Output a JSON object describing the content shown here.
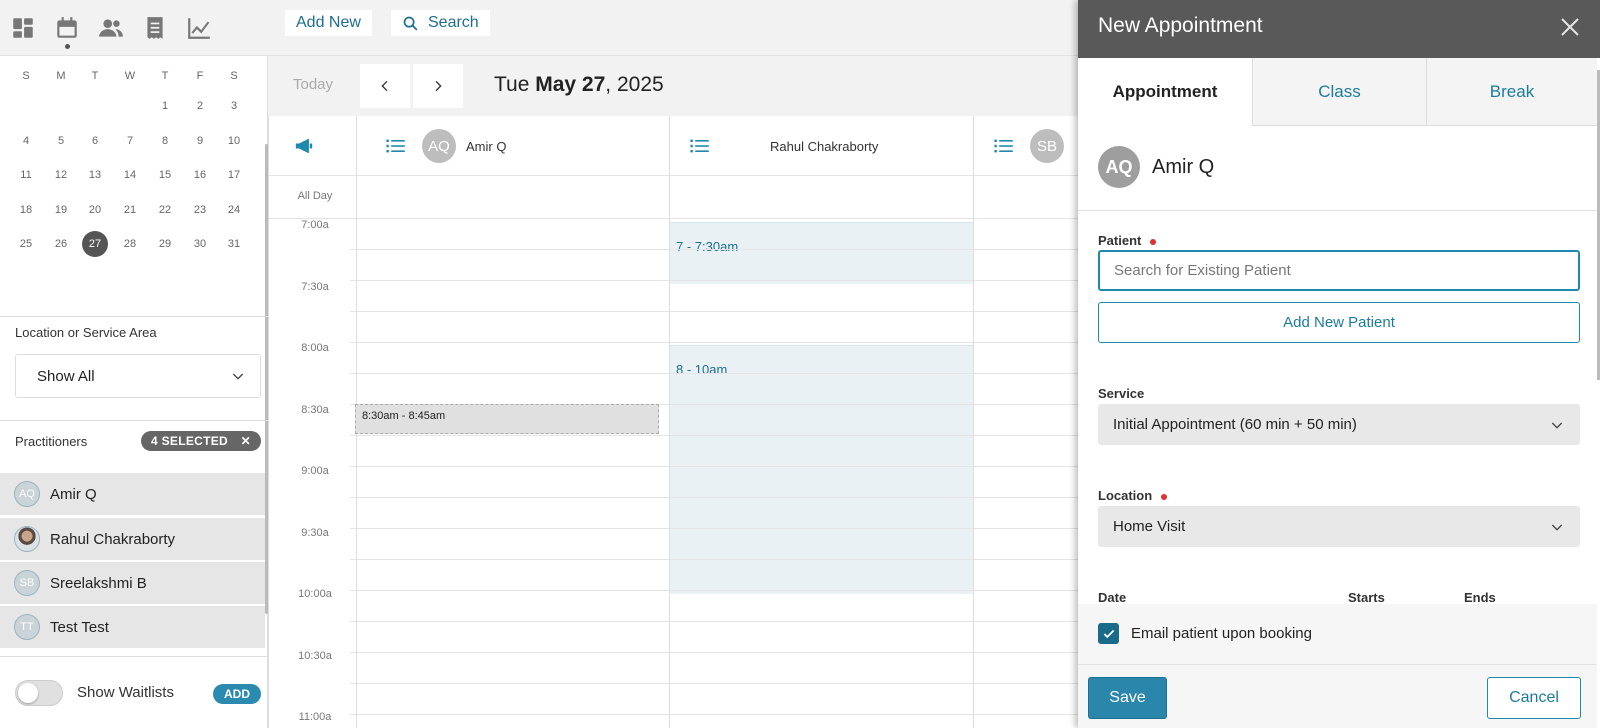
{
  "toolbar": {
    "add_new_label": "Add New",
    "search_label": "Search"
  },
  "mini_calendar": {
    "weekdays": [
      "S",
      "M",
      "T",
      "W",
      "T",
      "F",
      "S"
    ],
    "weeks": [
      [
        "",
        "",
        "",
        "",
        "1",
        "2",
        "3"
      ],
      [
        "4",
        "5",
        "6",
        "7",
        "8",
        "9",
        "10"
      ],
      [
        "11",
        "12",
        "13",
        "14",
        "15",
        "16",
        "17"
      ],
      [
        "18",
        "19",
        "20",
        "21",
        "22",
        "23",
        "24"
      ],
      [
        "25",
        "26",
        "27",
        "28",
        "29",
        "30",
        "31"
      ]
    ],
    "selected_day": "27"
  },
  "location_filter": {
    "label": "Location or Service Area",
    "value": "Show All"
  },
  "practitioners": {
    "label": "Practitioners",
    "selected_badge": "4 SELECTED",
    "list": [
      {
        "initials": "AQ",
        "name": "Amir Q"
      },
      {
        "initials": "",
        "name": "Rahul Chakraborty"
      },
      {
        "initials": "SB",
        "name": "Sreelakshmi B"
      },
      {
        "initials": "TT",
        "name": "Test Test"
      }
    ]
  },
  "waitlist": {
    "label": "Show Waitlists",
    "add_label": "ADD"
  },
  "calendar": {
    "today_label": "Today",
    "date_weekday": "Tue ",
    "date_bold": "May 27",
    "date_year": ", 2025",
    "all_day_label": "All Day",
    "columns": [
      {
        "initials": "AQ",
        "name": "Amir Q"
      },
      {
        "initials": "",
        "name": "Rahul Chakraborty"
      },
      {
        "initials": "SB",
        "name": ""
      }
    ],
    "time_labels": [
      "7:00a",
      "7:30a",
      "8:00a",
      "8:30a",
      "9:00a",
      "9:30a",
      "10:00a",
      "10:30a",
      "11:00a"
    ],
    "availability": [
      {
        "label": "7 - 7:30am"
      },
      {
        "label": "8 - 10am"
      }
    ],
    "pending_block": "8:30am - 8:45am"
  },
  "panel": {
    "title": "New Appointment",
    "tabs": [
      "Appointment",
      "Class",
      "Break"
    ],
    "practitioner_initials": "AQ",
    "practitioner_name": "Amir Q",
    "patient_label": "Patient",
    "patient_placeholder": "Search for Existing Patient",
    "add_patient_label": "Add New Patient",
    "service_label": "Service",
    "service_value": "Initial Appointment (60 min + 50 min)",
    "location_label": "Location",
    "location_value": "Home Visit",
    "date_header": "Date",
    "starts_header": "Starts",
    "ends_header": "Ends",
    "email_label": "Email patient upon booking",
    "email_checked": true,
    "save_label": "Save",
    "cancel_label": "Cancel"
  },
  "colors": {
    "accent": "#2a86aa",
    "link": "#1c7c9c",
    "header_bg": "#595959",
    "availability_bg": "#e9f1f4",
    "required_dot": "#e03030"
  }
}
